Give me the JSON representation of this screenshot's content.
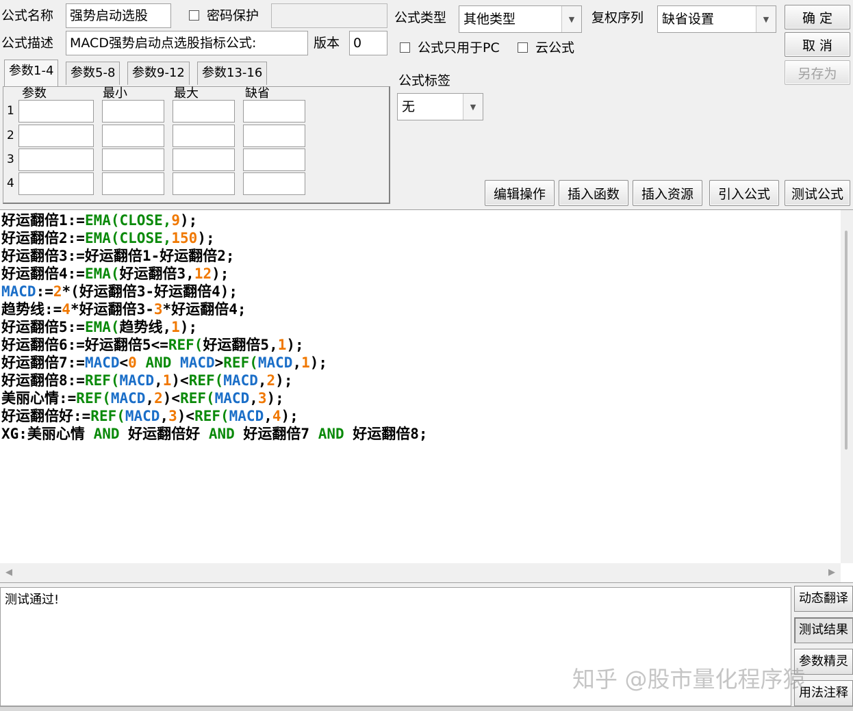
{
  "header": {
    "name_label": "公式名称",
    "name_value": "强势启动选股",
    "password_label": "密码保护",
    "password_value": "",
    "desc_label": "公式描述",
    "desc_value": "MACD强势启动点选股指标公式:",
    "version_label": "版本",
    "version_value": "0",
    "type_label": "公式类型",
    "type_value": "其他类型",
    "rights_label": "复权序列",
    "rights_value": "缺省设置",
    "pc_only_label": "公式只用于PC",
    "cloud_label": "云公式",
    "tag_label": "公式标签",
    "tag_value": "无"
  },
  "buttons": {
    "ok": "确 定",
    "cancel": "取 消",
    "save_as": "另存为",
    "edit_ops": "编辑操作",
    "insert_func": "插入函数",
    "insert_res": "插入资源",
    "import_formula": "引入公式",
    "test_formula": "测试公式"
  },
  "param_tabs": [
    "参数1-4",
    "参数5-8",
    "参数9-12",
    "参数13-16"
  ],
  "param_table": {
    "headers": [
      "参数",
      "最小",
      "最大",
      "缺省"
    ],
    "rows": [
      "1",
      "2",
      "3",
      "4"
    ]
  },
  "code_lines": [
    [
      {
        "t": "t",
        "s": "好运翻倍1:="
      },
      {
        "t": "k",
        "s": "EMA(CLOSE,"
      },
      {
        "t": "n",
        "s": "9"
      },
      {
        "t": "t",
        "s": ");"
      }
    ],
    [
      {
        "t": "t",
        "s": "好运翻倍2:="
      },
      {
        "t": "k",
        "s": "EMA(CLOSE,"
      },
      {
        "t": "n",
        "s": "150"
      },
      {
        "t": "t",
        "s": ");"
      }
    ],
    [
      {
        "t": "t",
        "s": "好运翻倍3:=好运翻倍1-好运翻倍2;"
      }
    ],
    [
      {
        "t": "t",
        "s": "好运翻倍4:="
      },
      {
        "t": "k",
        "s": "EMA("
      },
      {
        "t": "t",
        "s": "好运翻倍3,"
      },
      {
        "t": "n",
        "s": "12"
      },
      {
        "t": "t",
        "s": ");"
      }
    ],
    [
      {
        "t": "m",
        "s": "MACD"
      },
      {
        "t": "t",
        "s": ":="
      },
      {
        "t": "n",
        "s": "2"
      },
      {
        "t": "t",
        "s": "*(好运翻倍3-好运翻倍4);"
      }
    ],
    [
      {
        "t": "t",
        "s": "趋势线:="
      },
      {
        "t": "n",
        "s": "4"
      },
      {
        "t": "t",
        "s": "*好运翻倍3-"
      },
      {
        "t": "n",
        "s": "3"
      },
      {
        "t": "t",
        "s": "*好运翻倍4;"
      }
    ],
    [
      {
        "t": "t",
        "s": "好运翻倍5:="
      },
      {
        "t": "k",
        "s": "EMA("
      },
      {
        "t": "t",
        "s": "趋势线,"
      },
      {
        "t": "n",
        "s": "1"
      },
      {
        "t": "t",
        "s": ");"
      }
    ],
    [
      {
        "t": "t",
        "s": "好运翻倍6:=好运翻倍5<="
      },
      {
        "t": "k",
        "s": "REF("
      },
      {
        "t": "t",
        "s": "好运翻倍5,"
      },
      {
        "t": "n",
        "s": "1"
      },
      {
        "t": "t",
        "s": ");"
      }
    ],
    [
      {
        "t": "t",
        "s": "好运翻倍7:="
      },
      {
        "t": "m",
        "s": "MACD"
      },
      {
        "t": "t",
        "s": "<"
      },
      {
        "t": "n",
        "s": "0"
      },
      {
        "t": "k",
        "s": " AND "
      },
      {
        "t": "m",
        "s": "MACD"
      },
      {
        "t": "t",
        "s": ">"
      },
      {
        "t": "k",
        "s": "REF("
      },
      {
        "t": "m",
        "s": "MACD"
      },
      {
        "t": "t",
        "s": ","
      },
      {
        "t": "n",
        "s": "1"
      },
      {
        "t": "t",
        "s": ");"
      }
    ],
    [
      {
        "t": "t",
        "s": "好运翻倍8:="
      },
      {
        "t": "k",
        "s": "REF("
      },
      {
        "t": "m",
        "s": "MACD"
      },
      {
        "t": "t",
        "s": ","
      },
      {
        "t": "n",
        "s": "1"
      },
      {
        "t": "t",
        "s": ")<"
      },
      {
        "t": "k",
        "s": "REF("
      },
      {
        "t": "m",
        "s": "MACD"
      },
      {
        "t": "t",
        "s": ","
      },
      {
        "t": "n",
        "s": "2"
      },
      {
        "t": "t",
        "s": ");"
      }
    ],
    [
      {
        "t": "t",
        "s": "美丽心情:="
      },
      {
        "t": "k",
        "s": "REF("
      },
      {
        "t": "m",
        "s": "MACD"
      },
      {
        "t": "t",
        "s": ","
      },
      {
        "t": "n",
        "s": "2"
      },
      {
        "t": "t",
        "s": ")<"
      },
      {
        "t": "k",
        "s": "REF("
      },
      {
        "t": "m",
        "s": "MACD"
      },
      {
        "t": "t",
        "s": ","
      },
      {
        "t": "n",
        "s": "3"
      },
      {
        "t": "t",
        "s": ");"
      }
    ],
    [
      {
        "t": "t",
        "s": "好运翻倍好:="
      },
      {
        "t": "k",
        "s": "REF("
      },
      {
        "t": "m",
        "s": "MACD"
      },
      {
        "t": "t",
        "s": ","
      },
      {
        "t": "n",
        "s": "3"
      },
      {
        "t": "t",
        "s": ")<"
      },
      {
        "t": "k",
        "s": "REF("
      },
      {
        "t": "m",
        "s": "MACD"
      },
      {
        "t": "t",
        "s": ","
      },
      {
        "t": "n",
        "s": "4"
      },
      {
        "t": "t",
        "s": ");"
      }
    ],
    [
      {
        "t": "t",
        "s": "XG:美丽心情 "
      },
      {
        "t": "k",
        "s": "AND"
      },
      {
        "t": "t",
        "s": " 好运翻倍好 "
      },
      {
        "t": "k",
        "s": "AND"
      },
      {
        "t": "t",
        "s": " 好运翻倍7 "
      },
      {
        "t": "k",
        "s": "AND"
      },
      {
        "t": "t",
        "s": " 好运翻倍8;"
      }
    ]
  ],
  "output": {
    "text": "测试通过!"
  },
  "side_buttons": [
    "动态翻译",
    "测试结果",
    "参数精灵",
    "用法注释"
  ],
  "watermark": "知乎 @股市量化程序猿"
}
